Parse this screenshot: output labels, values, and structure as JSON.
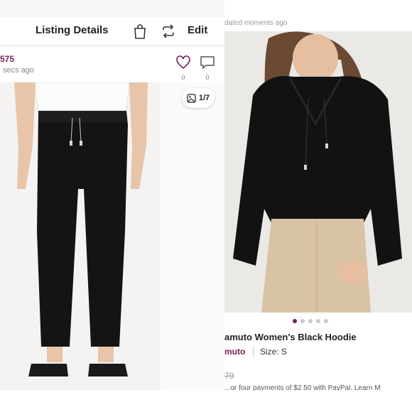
{
  "left": {
    "header": {
      "title": "Listing Details",
      "edit_label": "Edit"
    },
    "user": {
      "id_fragment": "575",
      "time_fragment": "secs ago"
    },
    "actions": {
      "likes_count": "0",
      "comments_count": "0"
    },
    "photo": {
      "counter": "1/7"
    }
  },
  "right": {
    "updated_fragment": "dated moments ago",
    "carousel": {
      "total": 5,
      "active": 0
    },
    "title_fragment": "amuto Women's Black Hoodie",
    "brand_fragment": "muto",
    "size_label": "Size: S",
    "price_fragment": "79",
    "promo_fragment": "...or four payments of $2.50 with PayPal. Learn M"
  },
  "colors": {
    "brand_purple": "#7b1d5a",
    "paypal_blue": "#1a3c8f"
  }
}
